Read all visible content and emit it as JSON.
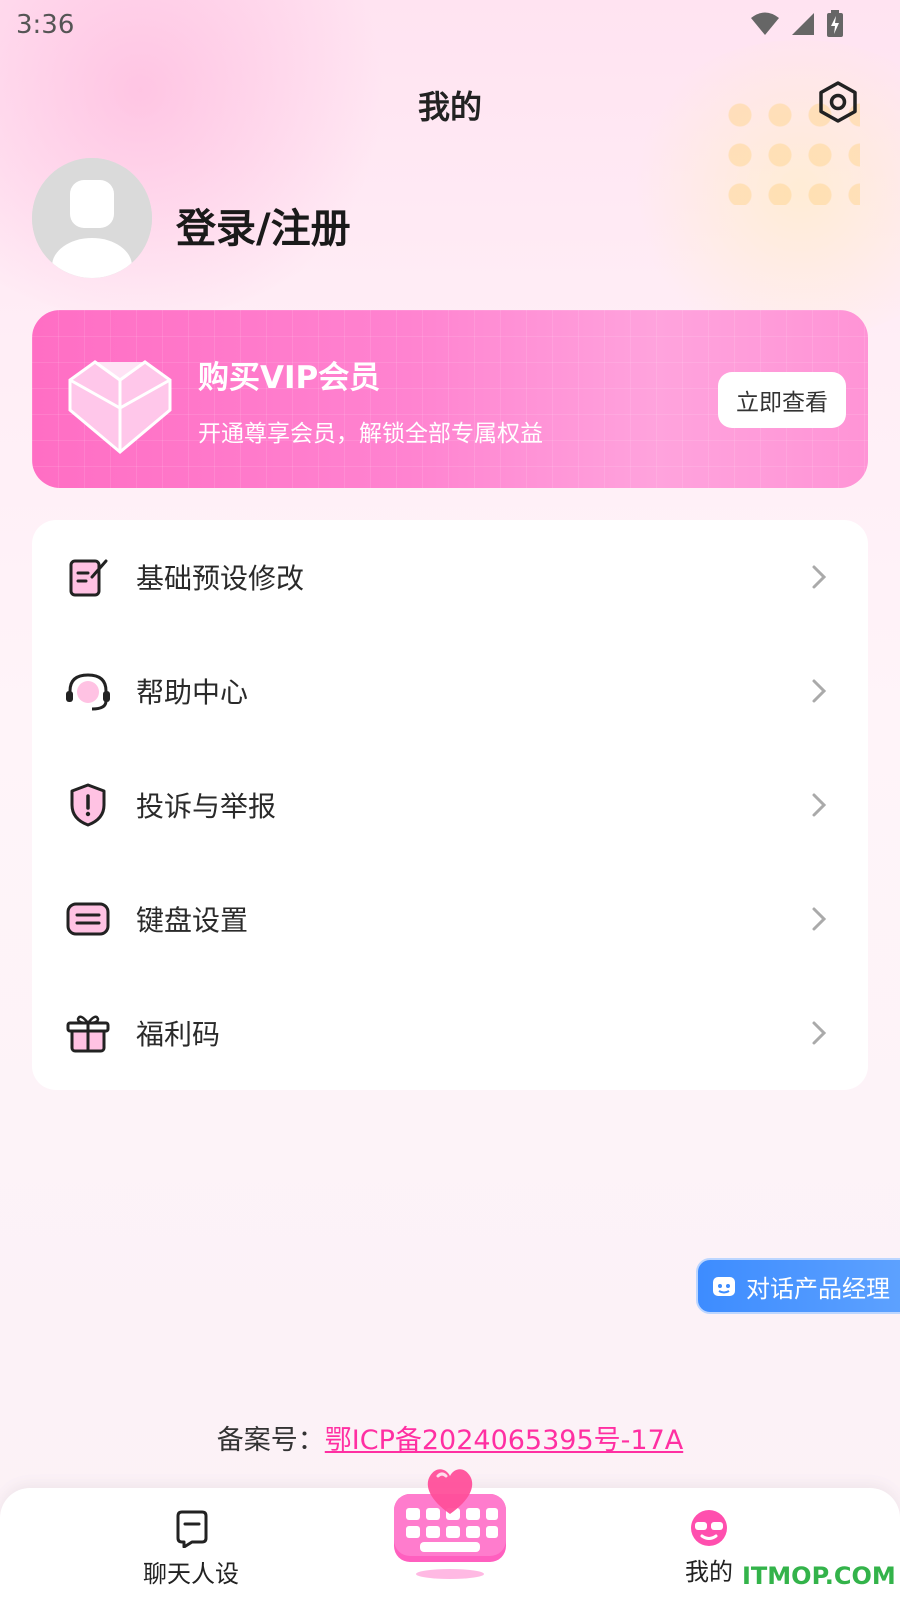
{
  "status_bar": {
    "time": "3:36",
    "icons": [
      "wifi-icon",
      "signal-icon",
      "battery-charging-icon"
    ]
  },
  "header": {
    "title": "我的",
    "settings_icon": "settings-icon"
  },
  "profile": {
    "login_text": "登录/注册",
    "avatar_icon": "default-avatar"
  },
  "vip_banner": {
    "title": "购买VIP会员",
    "subtitle": "开通尊享会员，解锁全部专属权益",
    "button_label": "立即查看",
    "colors": {
      "start": "#ff6ec4",
      "end": "#ffa3dd"
    }
  },
  "menu": {
    "items": [
      {
        "label": "基础预设修改",
        "icon": "edit-note-icon"
      },
      {
        "label": "帮助中心",
        "icon": "headset-icon"
      },
      {
        "label": "投诉与举报",
        "icon": "shield-alert-icon"
      },
      {
        "label": "键盘设置",
        "icon": "keyboard-icon"
      },
      {
        "label": "福利码",
        "icon": "gift-icon"
      }
    ]
  },
  "floating_button": {
    "label": "对话产品经理",
    "icon": "chat-icon"
  },
  "footer": {
    "icp_prefix": "备案号：",
    "icp_number": "鄂ICP备2024065395号-17A"
  },
  "tab_bar": {
    "tabs": [
      {
        "label": "聊天人设",
        "icon": "chat-persona-icon"
      },
      {
        "label": "",
        "icon": "heart-keyboard-icon"
      },
      {
        "label": "我的",
        "icon": "mine-icon",
        "active": true
      }
    ]
  },
  "watermark": "ITMOP.COM",
  "accent_color": "#ff2fa2"
}
